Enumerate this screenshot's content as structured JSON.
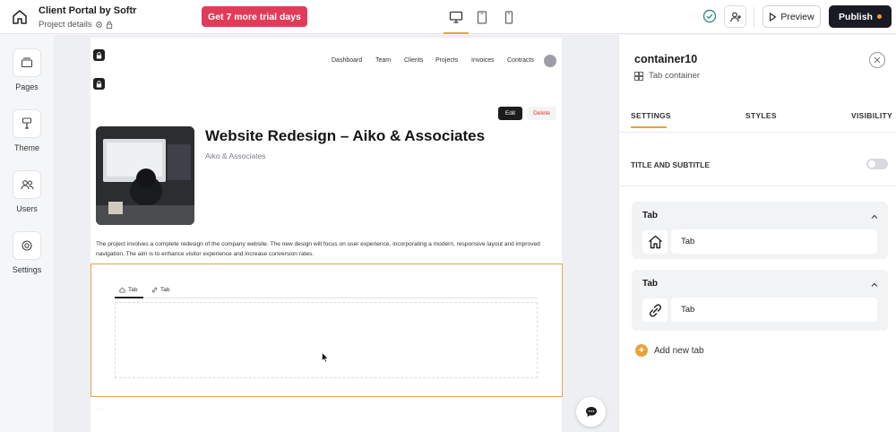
{
  "header": {
    "project_title": "Client Portal by Softr",
    "project_details": "Project details",
    "trial_button": "Get 7 more trial days",
    "preview_button": "Preview",
    "publish_button": "Publish",
    "accent_color": "#e03c5a"
  },
  "leftbar": {
    "items": [
      {
        "label": "Pages",
        "icon": "pages-icon"
      },
      {
        "label": "Theme",
        "icon": "theme-icon"
      },
      {
        "label": "Users",
        "icon": "users-icon"
      },
      {
        "label": "Settings",
        "icon": "settings-icon"
      }
    ]
  },
  "canvas": {
    "nav": [
      "Dashboard",
      "Team",
      "Clients",
      "Projects",
      "Invoices",
      "Contracts"
    ],
    "edit_button": "Edit",
    "delete_button": "Delete",
    "title": "Website Redesign – Aiko & Associates",
    "subtitle": "Aiko & Associates",
    "description": "The project involves a complete redesign of the company website. The new design will focus on user experience, incorporating a modern, responsive layout and improved navigation. The aim is to enhance visitor experience and increase conversion rates.",
    "tabs": [
      "Tab",
      "Tab"
    ]
  },
  "panel": {
    "title": "container10",
    "type": "Tab container",
    "tabs": [
      "SETTINGS",
      "STYLES",
      "VISIBILITY"
    ],
    "title_subtitle_label": "TITLE AND SUBTITLE",
    "title_subtitle_on": false,
    "tab_cards": [
      {
        "header": "Tab",
        "name": "Tab",
        "icon": "home-icon"
      },
      {
        "header": "Tab",
        "name": "Tab",
        "icon": "link-icon"
      }
    ],
    "add_tab_label": "Add new tab"
  }
}
